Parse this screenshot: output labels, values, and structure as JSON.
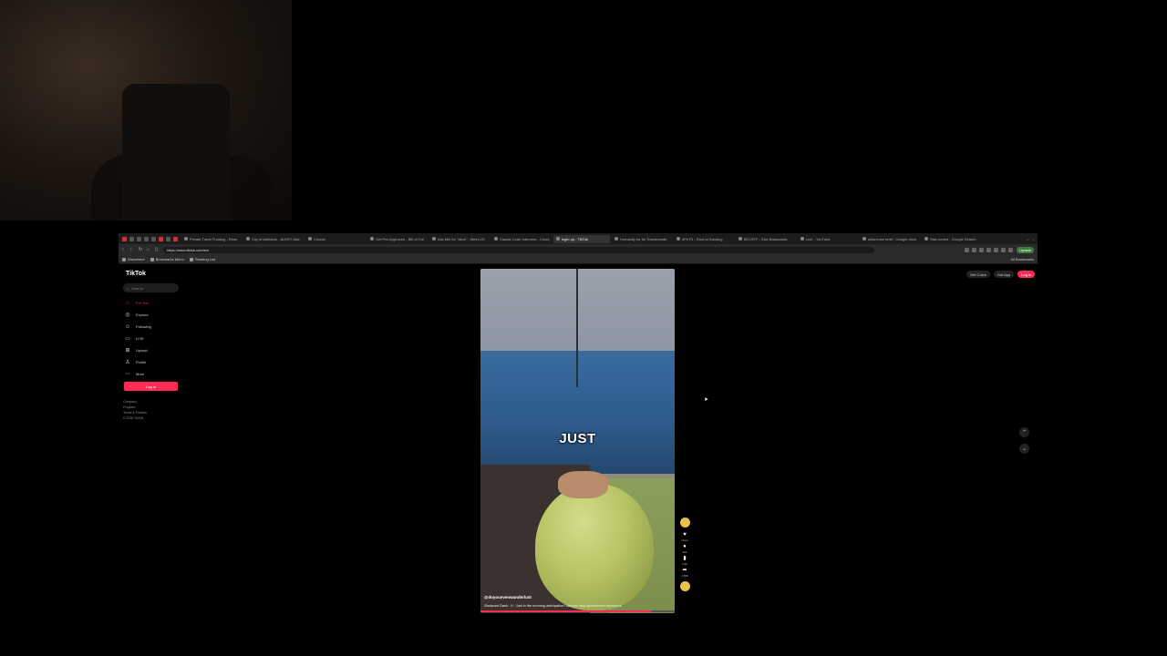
{
  "browser": {
    "tabs": [
      {
        "label": "Private Trade Funding - Rese"
      },
      {
        "label": "City of Adelanto - ALERT Mac"
      },
      {
        "label": "Clouds"
      },
      {
        "label": "Get Pre-Approved - Bill of Cre"
      },
      {
        "label": "Ask Mei for \"deck\" - Meet US"
      },
      {
        "label": "Claude Code Interview - Cloud"
      },
      {
        "label": "login up - TikTok",
        "active": true
      },
      {
        "label": "Humanity for Its Transformati"
      },
      {
        "label": "#PeTS - Roof at Sanding"
      },
      {
        "label": "BTCSTF - Kick Backwards"
      },
      {
        "label": "Live - YouTube"
      },
      {
        "label": "adberrose brief - Google docs"
      },
      {
        "label": "Stat control - Google Search"
      }
    ],
    "url": "https://www.tiktok.com/en/",
    "update_label": "Update",
    "bookmarks": [
      {
        "label": "Elsewhere"
      },
      {
        "label": "Bookmarks Menu"
      },
      {
        "label": "Reading List"
      }
    ],
    "all_bookmarks_label": "All Bookmarks"
  },
  "tiktok": {
    "logo": "TikTok",
    "search_placeholder": "Search",
    "nav": [
      {
        "label": "For You",
        "icon": "home-icon",
        "glyph": "⌂",
        "active": true
      },
      {
        "label": "Explore",
        "icon": "compass-icon",
        "glyph": "◎"
      },
      {
        "label": "Following",
        "icon": "following-icon",
        "glyph": "☺"
      },
      {
        "label": "LIVE",
        "icon": "live-icon",
        "glyph": "▭"
      },
      {
        "label": "Upload",
        "icon": "upload-icon",
        "glyph": "⊞"
      },
      {
        "label": "Profile",
        "icon": "profile-icon",
        "glyph": "♙"
      },
      {
        "label": "More",
        "icon": "more-icon",
        "glyph": "⋯"
      }
    ],
    "login_button": "Log in",
    "footer": [
      "Company",
      "Program",
      "Terms & Policies",
      "© 2025 TikTok"
    ],
    "top_right": {
      "get_coins": "Get Coins",
      "get_app": "Get App",
      "login": "Log in"
    }
  },
  "video": {
    "caption_word": "JUST",
    "author": "@doyouevenwanderlust",
    "description": "Starlaced Dank · 9 · Just in the morning anticipation? #anime #fyp #pineneedle #outdoors",
    "progress": 0.88,
    "actions": [
      {
        "icon": "heart-icon",
        "glyph": "♥",
        "count": "None"
      },
      {
        "icon": "comment-icon",
        "glyph": "●",
        "count": "161"
      },
      {
        "icon": "bookmark-icon",
        "glyph": "▮",
        "count": "1,3k"
      },
      {
        "icon": "share-icon",
        "glyph": "➦",
        "count": "1,658"
      }
    ]
  },
  "scroll": {
    "up_glyph": "⌃",
    "down_glyph": "⌄"
  },
  "colors": {
    "accent": "#fe2c55",
    "background": "#000000"
  }
}
